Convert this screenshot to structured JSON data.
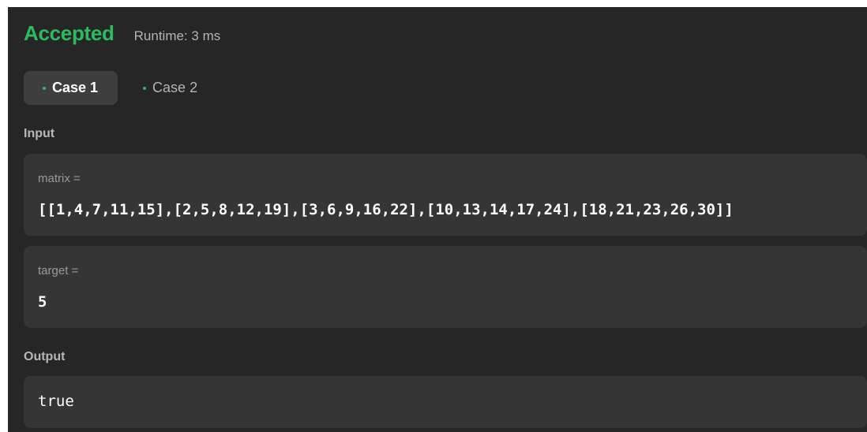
{
  "result": {
    "status": "Accepted",
    "runtime": "Runtime: 3 ms"
  },
  "tabs": [
    {
      "label": "Case 1",
      "active": true
    },
    {
      "label": "Case 2",
      "active": false
    }
  ],
  "input": {
    "label": "Input",
    "params": [
      {
        "name": "matrix =",
        "value": "[[1,4,7,11,15],[2,5,8,12,19],[3,6,9,16,22],[10,13,14,17,24],[18,21,23,26,30]]"
      },
      {
        "name": "target =",
        "value": "5"
      }
    ]
  },
  "output": {
    "label": "Output",
    "value": "true"
  },
  "colors": {
    "accepted": "#2cbb5d",
    "background": "#262626",
    "box": "#353535",
    "active_tab": "#3e3e3e"
  }
}
